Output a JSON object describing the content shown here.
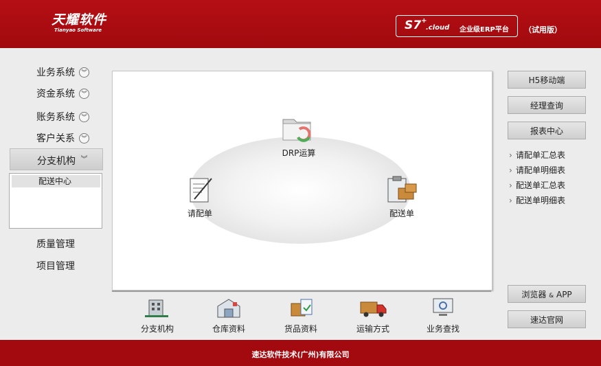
{
  "header": {
    "logo_main": "天耀软件",
    "logo_sub": "Tianyao Software",
    "product_badge": "S7",
    "product_plus": "+",
    "product_cloud": ".cloud",
    "platform_name": "企业级ERP平台",
    "trial_label": "（试用版）"
  },
  "sidebar": {
    "items": [
      {
        "label": "业务系统"
      },
      {
        "label": "资金系统"
      },
      {
        "label": "账务系统"
      },
      {
        "label": "客户关系"
      },
      {
        "label": "分支机构"
      },
      {
        "label": "质量管理"
      },
      {
        "label": "项目管理"
      }
    ],
    "sub_items": [
      {
        "label": "配送中心"
      }
    ]
  },
  "flow": {
    "drp": "DRP运算",
    "request": "请配单",
    "delivery": "配送单"
  },
  "bottom": {
    "items": [
      {
        "label": "分支机构",
        "icon": "building-icon"
      },
      {
        "label": "仓库资料",
        "icon": "warehouse-icon"
      },
      {
        "label": "货品资料",
        "icon": "goods-icon"
      },
      {
        "label": "运输方式",
        "icon": "truck-icon"
      },
      {
        "label": "业务查找",
        "icon": "monitor-search-icon"
      }
    ]
  },
  "right": {
    "h5": "H5移动端",
    "manager": "经理查询",
    "report_center": "报表中心",
    "reports": [
      {
        "label": "请配单汇总表"
      },
      {
        "label": "请配单明细表"
      },
      {
        "label": "配送单汇总表"
      },
      {
        "label": "配送单明细表"
      }
    ],
    "browser_pre": "浏览器 ",
    "browser_amp": "&",
    "browser_post": " APP",
    "official": "速达官网"
  },
  "footer": {
    "company": "速达软件技术(广州)有限公司"
  },
  "colors": {
    "brand_red": "#b50f14",
    "footer_red": "#a30a0f"
  }
}
